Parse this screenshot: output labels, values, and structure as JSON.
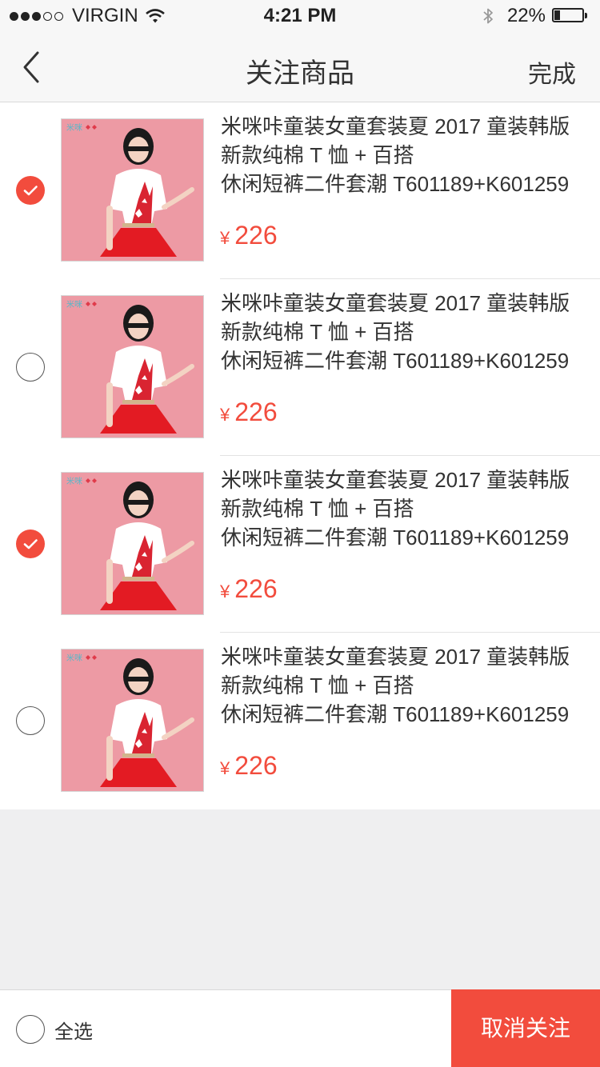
{
  "status_bar": {
    "carrier": "VIRGIN",
    "time": "4:21 PM",
    "battery_text": "22%",
    "battery_level": 0.22,
    "signal_filled": 3,
    "signal_total": 5
  },
  "nav": {
    "back_icon": "chevron-left-icon",
    "title": "关注商品",
    "done_label": "完成"
  },
  "products": [
    {
      "checked": true,
      "title_lines": [
        "米咪咔童装女童套装夏 2017 童装韩版",
        "新款纯棉 T 恤 + 百搭",
        "休闲短裤二件套潮 T601189+K601259"
      ],
      "currency": "¥",
      "price": "226"
    },
    {
      "checked": false,
      "title_lines": [
        "米咪咔童装女童套装夏 2017 童装韩版",
        "新款纯棉 T 恤 + 百搭",
        "休闲短裤二件套潮 T601189+K601259"
      ],
      "currency": "¥",
      "price": "226"
    },
    {
      "checked": true,
      "title_lines": [
        "米咪咔童装女童套装夏 2017 童装韩版",
        "新款纯棉 T 恤 + 百搭",
        "休闲短裤二件套潮 T601189+K601259"
      ],
      "currency": "¥",
      "price": "226"
    },
    {
      "checked": false,
      "title_lines": [
        "米咪咔童装女童套装夏 2017 童装韩版",
        "新款纯棉 T 恤 + 百搭",
        "休闲短裤二件套潮 T601189+K601259"
      ],
      "currency": "¥",
      "price": "226"
    }
  ],
  "bottom": {
    "select_all_label": "全选",
    "select_all_checked": false,
    "unfollow_label": "取消关注"
  },
  "colors": {
    "accent": "#f24c3d",
    "thumb_background": "#ed9aa4"
  }
}
